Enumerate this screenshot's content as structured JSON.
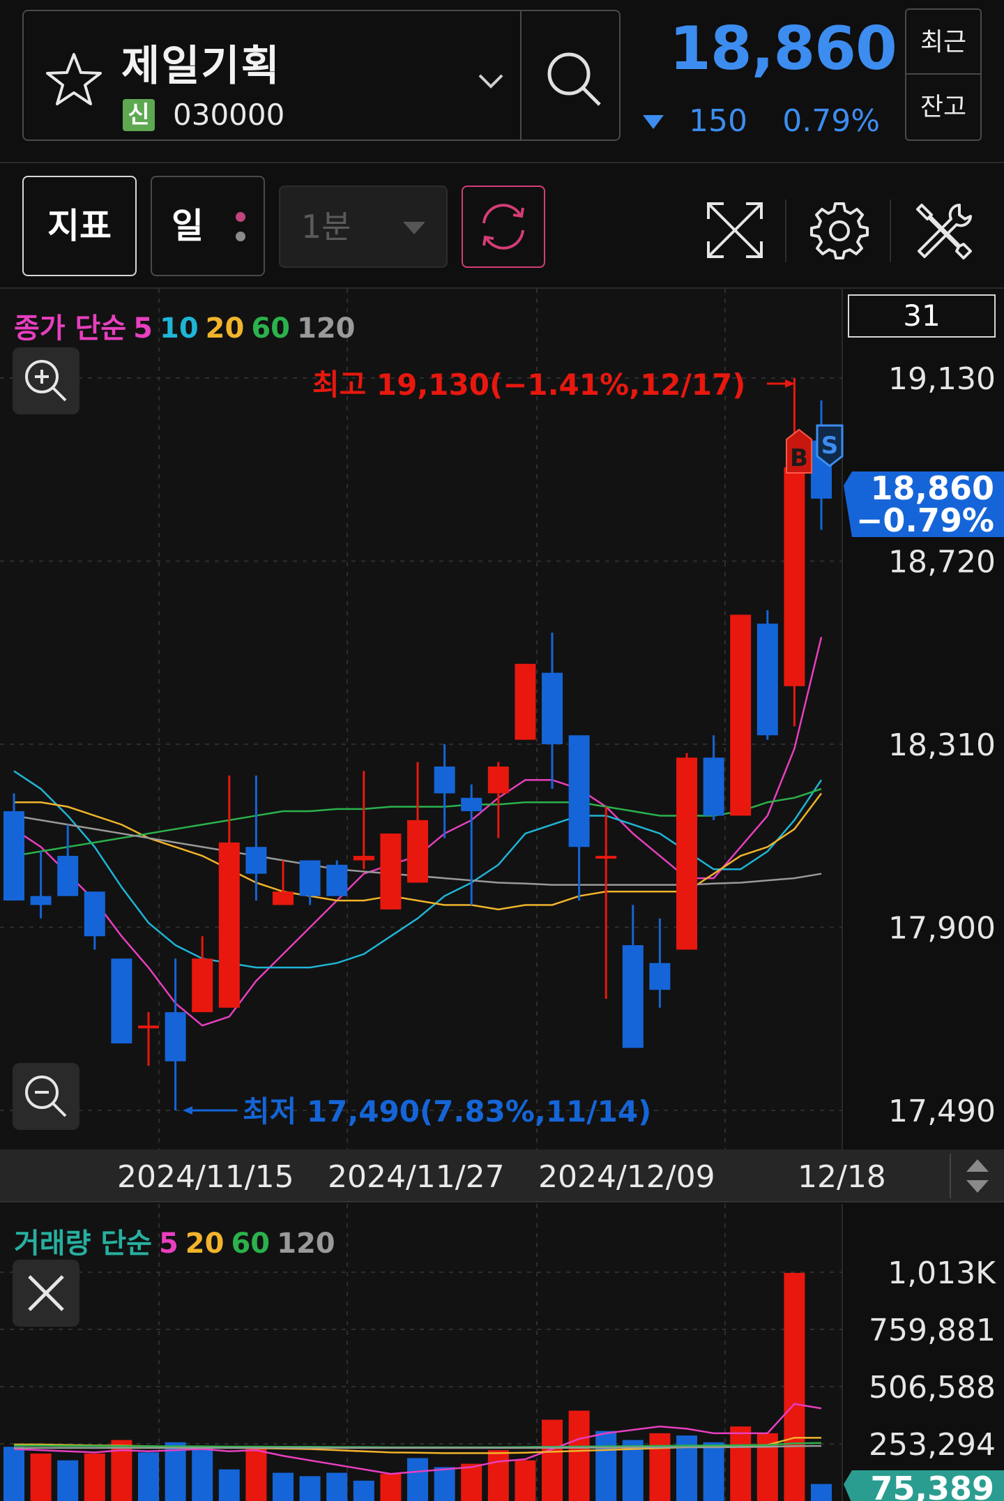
{
  "header": {
    "stock_name": "제일기획",
    "credit_badge": "신",
    "stock_code": "030000",
    "price": "18,860",
    "change_amount": "150",
    "change_pct": "0.79%",
    "side_buttons": [
      "최근",
      "잔고"
    ],
    "colors": {
      "down": "#3d8df0",
      "badge": "#5da850"
    }
  },
  "toolbar": {
    "indicator_label": "지표",
    "period_label": "일",
    "interval_label": "1분"
  },
  "price_chart": {
    "legend": {
      "title": "종가 단순",
      "periods": [
        {
          "label": "5",
          "color": "#e83fbf"
        },
        {
          "label": "10",
          "color": "#1fb5d6"
        },
        {
          "label": "20",
          "color": "#f2b42b"
        },
        {
          "label": "60",
          "color": "#2bb24c"
        },
        {
          "label": "120",
          "color": "#9a9a9a"
        }
      ]
    },
    "days_visible": "31",
    "high_annotation": "최고 19,130(−1.41%,12/17)",
    "low_annotation": "최저 17,490(7.83%,11/14)",
    "current_tag": {
      "price": "18,860",
      "pct": "−0.79%"
    },
    "buy_marker": "B",
    "sell_marker": "S",
    "x_labels": [
      "2024/11/15",
      "2024/11/27",
      "2024/12/09",
      "12/18"
    ]
  },
  "chart_data": [
    {
      "type": "candlestick",
      "y_ticks": [
        "19,130",
        "18,720",
        "18,310",
        "17,900",
        "17,490"
      ],
      "ylim": [
        17490,
        19130
      ],
      "up_color": "#e8180f",
      "down_color": "#1565d8",
      "candles": [
        {
          "o": 18160,
          "h": 18200,
          "l": 17960,
          "c": 17960
        },
        {
          "o": 17970,
          "h": 18070,
          "l": 17920,
          "c": 17950
        },
        {
          "o": 18060,
          "h": 18130,
          "l": 17970,
          "c": 17970
        },
        {
          "o": 17980,
          "h": 17980,
          "l": 17850,
          "c": 17880
        },
        {
          "o": 17830,
          "h": 17830,
          "l": 17640,
          "c": 17640
        },
        {
          "o": 17680,
          "h": 17710,
          "l": 17590,
          "c": 17680
        },
        {
          "o": 17710,
          "h": 17830,
          "l": 17490,
          "c": 17600
        },
        {
          "o": 17710,
          "h": 17880,
          "l": 17710,
          "c": 17830
        },
        {
          "o": 17720,
          "h": 18240,
          "l": 17720,
          "c": 18090
        },
        {
          "o": 18080,
          "h": 18240,
          "l": 17960,
          "c": 18020
        },
        {
          "o": 17950,
          "h": 18050,
          "l": 17950,
          "c": 17980
        },
        {
          "o": 18050,
          "h": 18050,
          "l": 17950,
          "c": 17970
        },
        {
          "o": 18040,
          "h": 18050,
          "l": 17980,
          "c": 17970
        },
        {
          "o": 18050,
          "h": 18250,
          "l": 18030,
          "c": 18060
        },
        {
          "o": 17940,
          "h": 18110,
          "l": 17940,
          "c": 18110
        },
        {
          "o": 18000,
          "h": 18270,
          "l": 18000,
          "c": 18140
        },
        {
          "o": 18260,
          "h": 18310,
          "l": 18100,
          "c": 18200
        },
        {
          "o": 18190,
          "h": 18220,
          "l": 17950,
          "c": 18160
        },
        {
          "o": 18200,
          "h": 18270,
          "l": 18100,
          "c": 18260
        },
        {
          "o": 18320,
          "h": 18490,
          "l": 18320,
          "c": 18490
        },
        {
          "o": 18470,
          "h": 18560,
          "l": 18210,
          "c": 18310
        },
        {
          "o": 18330,
          "h": 18330,
          "l": 17960,
          "c": 18080
        },
        {
          "o": 18060,
          "h": 18170,
          "l": 17740,
          "c": 18060
        },
        {
          "o": 17860,
          "h": 17950,
          "l": 17640,
          "c": 17630
        },
        {
          "o": 17820,
          "h": 17920,
          "l": 17720,
          "c": 17760
        },
        {
          "o": 17850,
          "h": 18290,
          "l": 17850,
          "c": 18280
        },
        {
          "o": 18280,
          "h": 18330,
          "l": 18140,
          "c": 18150
        },
        {
          "o": 18150,
          "h": 18600,
          "l": 18150,
          "c": 18600
        },
        {
          "o": 18580,
          "h": 18610,
          "l": 18320,
          "c": 18330
        },
        {
          "o": 18440,
          "h": 19130,
          "l": 18350,
          "c": 18930
        },
        {
          "o": 18990,
          "h": 19080,
          "l": 18790,
          "c": 18860
        }
      ],
      "moving_averages": [
        {
          "name": "5",
          "color": "#e83fbf",
          "values": [
            18120,
            18080,
            18020,
            17960,
            17880,
            17810,
            17730,
            17680,
            17700,
            17780,
            17840,
            17900,
            17960,
            18020,
            18040,
            18060,
            18110,
            18140,
            18190,
            18230,
            18230,
            18210,
            18170,
            18110,
            18060,
            18010,
            18010,
            18080,
            18150,
            18300,
            18550
          ]
        },
        {
          "name": "10",
          "color": "#1fb5d6",
          "values": [
            18250,
            18210,
            18150,
            18080,
            17990,
            17910,
            17860,
            17830,
            17820,
            17810,
            17810,
            17810,
            17820,
            17840,
            17880,
            17920,
            17970,
            18000,
            18040,
            18110,
            18130,
            18150,
            18150,
            18130,
            18110,
            18070,
            18030,
            18030,
            18070,
            18140,
            18230
          ]
        },
        {
          "name": "20",
          "color": "#f2b42b",
          "values": [
            18180,
            18180,
            18170,
            18150,
            18130,
            18100,
            18080,
            18060,
            18030,
            18000,
            17980,
            17970,
            17960,
            17960,
            17970,
            17960,
            17950,
            17950,
            17940,
            17950,
            17950,
            17970,
            17980,
            17980,
            17980,
            17980,
            18020,
            18060,
            18080,
            18120,
            18200
          ]
        },
        {
          "name": "60",
          "color": "#2bb24c",
          "values": [
            18060,
            18070,
            18080,
            18090,
            18100,
            18110,
            18120,
            18130,
            18140,
            18150,
            18160,
            18160,
            18165,
            18165,
            18170,
            18170,
            18170,
            18175,
            18175,
            18180,
            18180,
            18180,
            18170,
            18160,
            18150,
            18150,
            18150,
            18160,
            18180,
            18190,
            18210
          ]
        },
        {
          "name": "120",
          "color": "#9a9a9a",
          "values": [
            18150,
            18140,
            18130,
            18120,
            18110,
            18100,
            18090,
            18080,
            18070,
            18060,
            18050,
            18040,
            18030,
            18025,
            18020,
            18015,
            18010,
            18005,
            18000,
            17998,
            17995,
            17995,
            17995,
            17995,
            17995,
            17995,
            17998,
            18000,
            18005,
            18010,
            18020
          ]
        }
      ]
    },
    {
      "type": "bar",
      "y_ticks": [
        "1,013K",
        "759,881",
        "506,588",
        "253,294"
      ],
      "ylim": [
        0,
        1013000
      ],
      "current_tag": "75,389",
      "values": [
        240000,
        210000,
        180000,
        210000,
        270000,
        215000,
        260000,
        240000,
        140000,
        240000,
        125000,
        110000,
        125000,
        90000,
        120000,
        190000,
        150000,
        165000,
        225000,
        180000,
        360000,
        400000,
        310000,
        270000,
        300000,
        290000,
        260000,
        330000,
        300000,
        1010000,
        75389
      ],
      "up": [
        false,
        true,
        false,
        true,
        true,
        false,
        false,
        false,
        false,
        true,
        false,
        false,
        false,
        false,
        true,
        false,
        false,
        true,
        true,
        true,
        true,
        true,
        false,
        false,
        true,
        false,
        false,
        true,
        true,
        true,
        false
      ],
      "moving_averages": [
        {
          "name": "5",
          "color": "#e83fbf",
          "values": [
            230000,
            225000,
            220000,
            215000,
            225000,
            220000,
            225000,
            230000,
            220000,
            225000,
            200000,
            180000,
            160000,
            140000,
            120000,
            130000,
            140000,
            150000,
            175000,
            185000,
            230000,
            275000,
            300000,
            315000,
            330000,
            320000,
            300000,
            300000,
            300000,
            430000,
            410000
          ]
        },
        {
          "name": "20",
          "color": "#f2b42b",
          "values": [
            250000,
            250000,
            248000,
            246000,
            245000,
            243000,
            240000,
            238000,
            236000,
            234000,
            232000,
            230000,
            225000,
            220000,
            215000,
            214000,
            212000,
            212000,
            212000,
            214000,
            218000,
            222000,
            226000,
            230000,
            234000,
            238000,
            240000,
            244000,
            248000,
            280000,
            280000
          ]
        },
        {
          "name": "60",
          "color": "#2bb24c",
          "values": [
            245000,
            245000,
            244000,
            244000,
            243000,
            243000,
            242000,
            242000,
            241000,
            241000,
            240000,
            240000,
            239000,
            239000,
            238000,
            238000,
            238000,
            238000,
            238000,
            239000,
            240000,
            241000,
            242000,
            243000,
            244000,
            245000,
            246000,
            247000,
            248000,
            255000,
            257000
          ]
        },
        {
          "name": "120",
          "color": "#9a9a9a",
          "values": [
            235000,
            235000,
            235000,
            235000,
            235000,
            235000,
            235000,
            235000,
            235000,
            235000,
            235000,
            235000,
            235000,
            235000,
            235000,
            235000,
            235000,
            235000,
            235000,
            235000,
            235000,
            236000,
            236000,
            237000,
            237000,
            238000,
            238000,
            239000,
            240000,
            243000,
            244000
          ]
        }
      ]
    }
  ],
  "volume_chart": {
    "legend": {
      "title": "거래량 단순",
      "periods": [
        {
          "label": "5",
          "color": "#e83fbf"
        },
        {
          "label": "20",
          "color": "#f2b42b"
        },
        {
          "label": "60",
          "color": "#2bb24c"
        },
        {
          "label": "120",
          "color": "#9a9a9a"
        }
      ]
    }
  }
}
